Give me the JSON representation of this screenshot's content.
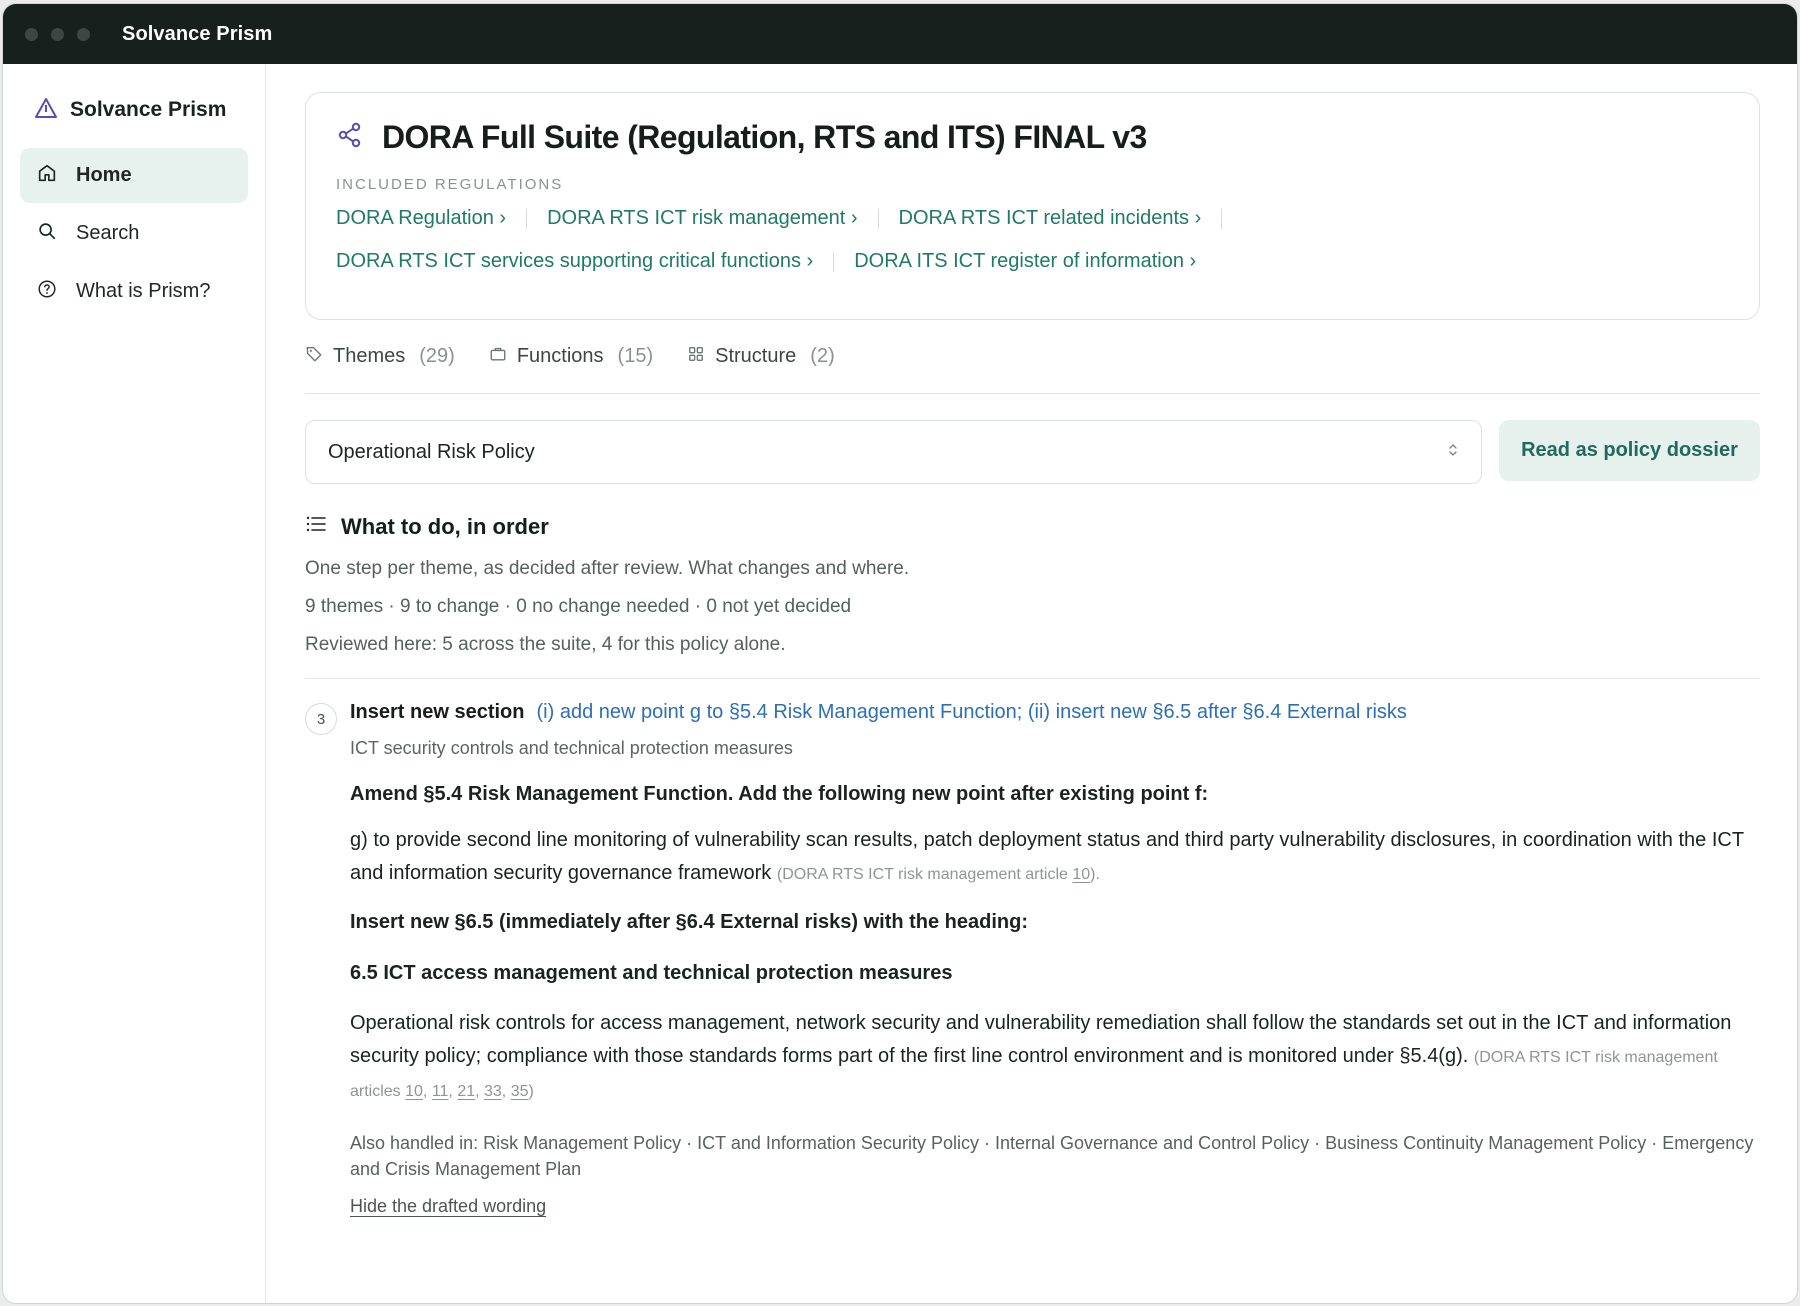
{
  "window": {
    "title": "Solvance Prism"
  },
  "sidebar": {
    "brand": "Solvance Prism",
    "items": [
      {
        "label": "Home",
        "icon": "home-icon",
        "active": true
      },
      {
        "label": "Search",
        "icon": "search-icon",
        "active": false
      },
      {
        "label": "What is Prism?",
        "icon": "help-circle-icon",
        "active": false
      }
    ]
  },
  "suite": {
    "title": "DORA Full Suite (Regulation, RTS and ITS) FINAL v3",
    "included_label": "INCLUDED REGULATIONS",
    "regulations_row1": [
      "DORA Regulation ›",
      "DORA RTS ICT risk management ›",
      "DORA RTS ICT related incidents ›"
    ],
    "regulations_row2": [
      "DORA RTS ICT services supporting critical functions ›",
      "DORA ITS ICT register of information ›"
    ]
  },
  "tabs": [
    {
      "label": "Themes",
      "count": "(29)"
    },
    {
      "label": "Functions",
      "count": "(15)"
    },
    {
      "label": "Structure",
      "count": "(2)"
    }
  ],
  "policy_select": {
    "value": "Operational Risk Policy"
  },
  "dossier_button": "Read as policy dossier",
  "plan": {
    "title": "What to do, in order",
    "description": "One step per theme, as decided after review. What changes and where.",
    "summary": "9 themes · 9 to change · 0 no change needed · 0 not yet decided",
    "reviewed": "Reviewed here: 5 across the suite, 4 for this policy alone."
  },
  "step": {
    "number": "3",
    "kind": "Insert new section",
    "where": "(i) add new point g to §5.4 Risk Management Function; (ii) insert new §6.5 after §6.4 External risks",
    "theme": "ICT security controls and technical protection measures",
    "draft": {
      "amend_heading": "Amend §5.4 Risk Management Function. Add the following new point after existing point f:",
      "point_g": "g) to provide second line monitoring of vulnerability scan results, patch deployment status and third party vulnerability disclosures, in coordination with the ICT and information security governance framework",
      "point_g_cite_prefix": "(DORA RTS ICT risk management article ",
      "point_g_cite_article": "10",
      "point_g_cite_suffix": ").",
      "insert_heading": "Insert new §6.5 (immediately after §6.4 External risks) with the heading:",
      "section_heading": "6.5 ICT access management and technical protection measures",
      "section_text": "Operational risk controls for access management, network security and vulnerability remediation shall follow the standards set out in the ICT and information security policy; compliance with those standards forms part of the first line control environment and is monitored under §5.4(g).",
      "section_cite_prefix": "(DORA RTS ICT risk management articles ",
      "section_cite_articles": [
        "10",
        "11",
        "21",
        "33",
        "35"
      ],
      "section_cite_suffix": ")"
    },
    "also_handled": "Also handled in: Risk Management Policy · ICT and Information Security Policy · Internal Governance and Control Policy · Business Continuity Management Policy · Emergency and Crisis Management Plan",
    "hide_link": "Hide the drafted wording"
  },
  "colors": {
    "titlebar": "#18201e",
    "accent_green": "#1f7a67",
    "link_blue": "#2d6fb4",
    "active_nav_bg": "#e7f2ef",
    "brand_icon": "#5b4bb8"
  }
}
